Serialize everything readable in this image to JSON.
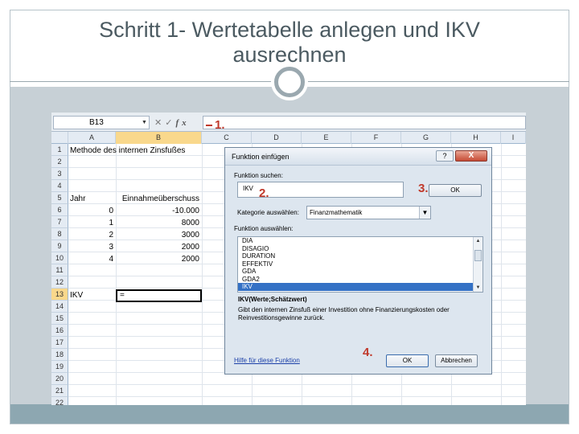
{
  "slide": {
    "title": "Schritt 1- Wertetabelle anlegen und IKV\nausrechnen"
  },
  "excel": {
    "name_box": "B13",
    "formula_tools": {
      "cancel": "✕",
      "enter": "✓",
      "fx": "fx"
    },
    "formula_value": "",
    "columns": [
      "A",
      "B",
      "C",
      "D",
      "E",
      "F",
      "G",
      "H",
      "I"
    ],
    "selected_column": "B",
    "rows": [
      "1",
      "2",
      "3",
      "4",
      "5",
      "6",
      "7",
      "8",
      "9",
      "10",
      "11",
      "12",
      "13",
      "14",
      "15",
      "16",
      "17",
      "18",
      "19",
      "20",
      "21",
      "22"
    ],
    "selected_row": "13",
    "cells": {
      "a1": "Methode des internen Zinsfußes",
      "a5": "Jahr",
      "b5": "Einnahmeüberschuss",
      "b6_year": "0",
      "b6_val": "-10.000",
      "b7_year": "1",
      "b7_val": "8000",
      "b8_year": "2",
      "b8_val": "3000",
      "b9_year": "3",
      "b9_val": "2000",
      "b10_year": "4",
      "b10_val": "2000",
      "a13": "IKV",
      "b13": "="
    }
  },
  "dialog": {
    "title": "Funktion einfügen",
    "help_button": "?",
    "close_button": "X",
    "search_label": "Funktion suchen:",
    "search_value": "IKV",
    "go_button": "OK",
    "category_label": "Kategorie auswählen:",
    "category_value": "Finanzmathematik",
    "function_list_label": "Funktion auswählen:",
    "functions": [
      "DIA",
      "DISAGIO",
      "DURATION",
      "EFFEKTIV",
      "GDA",
      "GDA2",
      "IKV"
    ],
    "selected_function": "IKV",
    "syntax": "IKV(Werte;Schätzwert)",
    "description": "Gibt den internen Zinsfuß einer Investition ohne Finanzierungskosten oder Reinvestitionsgewinne zurück.",
    "help_link": "Hilfe für diese Funktion",
    "ok_button": "OK",
    "cancel_button": "Abbrechen"
  },
  "annotations": {
    "step1": "1.",
    "step2": "2.",
    "step3": "3.",
    "step4": "4."
  },
  "colors": {
    "annotation_red": "#c0392b",
    "list_selection": "#3471c5",
    "footer_band": "#8da7b1",
    "content_bg": "#c7d0d6"
  }
}
